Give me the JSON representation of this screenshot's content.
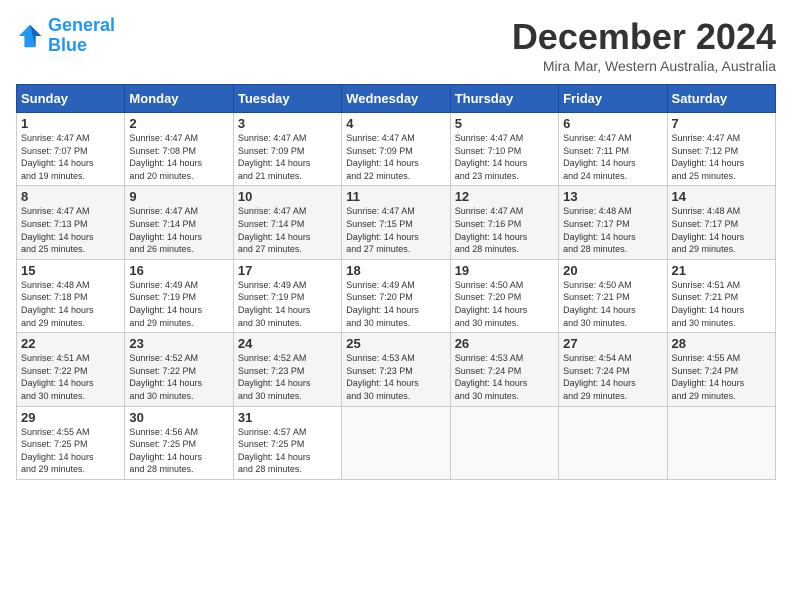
{
  "header": {
    "logo_line1": "General",
    "logo_line2": "Blue",
    "month_title": "December 2024",
    "location": "Mira Mar, Western Australia, Australia"
  },
  "calendar": {
    "days_of_week": [
      "Sunday",
      "Monday",
      "Tuesday",
      "Wednesday",
      "Thursday",
      "Friday",
      "Saturday"
    ],
    "weeks": [
      [
        {
          "day": "",
          "info": ""
        },
        {
          "day": "2",
          "info": "Sunrise: 4:47 AM\nSunset: 7:08 PM\nDaylight: 14 hours\nand 20 minutes."
        },
        {
          "day": "3",
          "info": "Sunrise: 4:47 AM\nSunset: 7:09 PM\nDaylight: 14 hours\nand 21 minutes."
        },
        {
          "day": "4",
          "info": "Sunrise: 4:47 AM\nSunset: 7:09 PM\nDaylight: 14 hours\nand 22 minutes."
        },
        {
          "day": "5",
          "info": "Sunrise: 4:47 AM\nSunset: 7:10 PM\nDaylight: 14 hours\nand 23 minutes."
        },
        {
          "day": "6",
          "info": "Sunrise: 4:47 AM\nSunset: 7:11 PM\nDaylight: 14 hours\nand 24 minutes."
        },
        {
          "day": "7",
          "info": "Sunrise: 4:47 AM\nSunset: 7:12 PM\nDaylight: 14 hours\nand 25 minutes."
        }
      ],
      [
        {
          "day": "1",
          "info": "Sunrise: 4:47 AM\nSunset: 7:07 PM\nDaylight: 14 hours\nand 19 minutes."
        },
        {
          "day": "",
          "info": ""
        },
        {
          "day": "",
          "info": ""
        },
        {
          "day": "",
          "info": ""
        },
        {
          "day": "",
          "info": ""
        },
        {
          "day": "",
          "info": ""
        },
        {
          "day": "",
          "info": ""
        }
      ],
      [
        {
          "day": "8",
          "info": "Sunrise: 4:47 AM\nSunset: 7:13 PM\nDaylight: 14 hours\nand 25 minutes."
        },
        {
          "day": "9",
          "info": "Sunrise: 4:47 AM\nSunset: 7:14 PM\nDaylight: 14 hours\nand 26 minutes."
        },
        {
          "day": "10",
          "info": "Sunrise: 4:47 AM\nSunset: 7:14 PM\nDaylight: 14 hours\nand 27 minutes."
        },
        {
          "day": "11",
          "info": "Sunrise: 4:47 AM\nSunset: 7:15 PM\nDaylight: 14 hours\nand 27 minutes."
        },
        {
          "day": "12",
          "info": "Sunrise: 4:47 AM\nSunset: 7:16 PM\nDaylight: 14 hours\nand 28 minutes."
        },
        {
          "day": "13",
          "info": "Sunrise: 4:48 AM\nSunset: 7:17 PM\nDaylight: 14 hours\nand 28 minutes."
        },
        {
          "day": "14",
          "info": "Sunrise: 4:48 AM\nSunset: 7:17 PM\nDaylight: 14 hours\nand 29 minutes."
        }
      ],
      [
        {
          "day": "15",
          "info": "Sunrise: 4:48 AM\nSunset: 7:18 PM\nDaylight: 14 hours\nand 29 minutes."
        },
        {
          "day": "16",
          "info": "Sunrise: 4:49 AM\nSunset: 7:19 PM\nDaylight: 14 hours\nand 29 minutes."
        },
        {
          "day": "17",
          "info": "Sunrise: 4:49 AM\nSunset: 7:19 PM\nDaylight: 14 hours\nand 30 minutes."
        },
        {
          "day": "18",
          "info": "Sunrise: 4:49 AM\nSunset: 7:20 PM\nDaylight: 14 hours\nand 30 minutes."
        },
        {
          "day": "19",
          "info": "Sunrise: 4:50 AM\nSunset: 7:20 PM\nDaylight: 14 hours\nand 30 minutes."
        },
        {
          "day": "20",
          "info": "Sunrise: 4:50 AM\nSunset: 7:21 PM\nDaylight: 14 hours\nand 30 minutes."
        },
        {
          "day": "21",
          "info": "Sunrise: 4:51 AM\nSunset: 7:21 PM\nDaylight: 14 hours\nand 30 minutes."
        }
      ],
      [
        {
          "day": "22",
          "info": "Sunrise: 4:51 AM\nSunset: 7:22 PM\nDaylight: 14 hours\nand 30 minutes."
        },
        {
          "day": "23",
          "info": "Sunrise: 4:52 AM\nSunset: 7:22 PM\nDaylight: 14 hours\nand 30 minutes."
        },
        {
          "day": "24",
          "info": "Sunrise: 4:52 AM\nSunset: 7:23 PM\nDaylight: 14 hours\nand 30 minutes."
        },
        {
          "day": "25",
          "info": "Sunrise: 4:53 AM\nSunset: 7:23 PM\nDaylight: 14 hours\nand 30 minutes."
        },
        {
          "day": "26",
          "info": "Sunrise: 4:53 AM\nSunset: 7:24 PM\nDaylight: 14 hours\nand 30 minutes."
        },
        {
          "day": "27",
          "info": "Sunrise: 4:54 AM\nSunset: 7:24 PM\nDaylight: 14 hours\nand 29 minutes."
        },
        {
          "day": "28",
          "info": "Sunrise: 4:55 AM\nSunset: 7:24 PM\nDaylight: 14 hours\nand 29 minutes."
        }
      ],
      [
        {
          "day": "29",
          "info": "Sunrise: 4:55 AM\nSunset: 7:25 PM\nDaylight: 14 hours\nand 29 minutes."
        },
        {
          "day": "30",
          "info": "Sunrise: 4:56 AM\nSunset: 7:25 PM\nDaylight: 14 hours\nand 28 minutes."
        },
        {
          "day": "31",
          "info": "Sunrise: 4:57 AM\nSunset: 7:25 PM\nDaylight: 14 hours\nand 28 minutes."
        },
        {
          "day": "",
          "info": ""
        },
        {
          "day": "",
          "info": ""
        },
        {
          "day": "",
          "info": ""
        },
        {
          "day": "",
          "info": ""
        }
      ]
    ]
  }
}
